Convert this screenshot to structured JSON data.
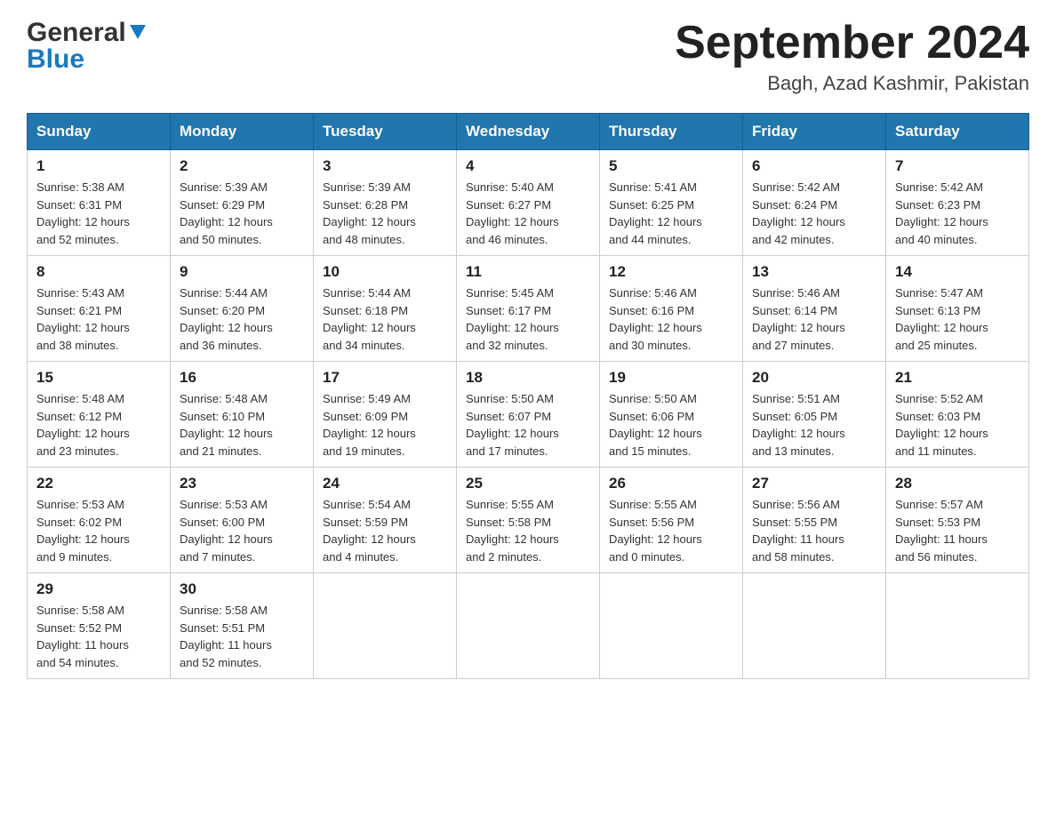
{
  "header": {
    "logo_general": "General",
    "logo_blue": "Blue",
    "month_title": "September 2024",
    "subtitle": "Bagh, Azad Kashmir, Pakistan"
  },
  "weekdays": [
    "Sunday",
    "Monday",
    "Tuesday",
    "Wednesday",
    "Thursday",
    "Friday",
    "Saturday"
  ],
  "weeks": [
    [
      {
        "day": "1",
        "sunrise": "5:38 AM",
        "sunset": "6:31 PM",
        "daylight": "12 hours and 52 minutes."
      },
      {
        "day": "2",
        "sunrise": "5:39 AM",
        "sunset": "6:29 PM",
        "daylight": "12 hours and 50 minutes."
      },
      {
        "day": "3",
        "sunrise": "5:39 AM",
        "sunset": "6:28 PM",
        "daylight": "12 hours and 48 minutes."
      },
      {
        "day": "4",
        "sunrise": "5:40 AM",
        "sunset": "6:27 PM",
        "daylight": "12 hours and 46 minutes."
      },
      {
        "day": "5",
        "sunrise": "5:41 AM",
        "sunset": "6:25 PM",
        "daylight": "12 hours and 44 minutes."
      },
      {
        "day": "6",
        "sunrise": "5:42 AM",
        "sunset": "6:24 PM",
        "daylight": "12 hours and 42 minutes."
      },
      {
        "day": "7",
        "sunrise": "5:42 AM",
        "sunset": "6:23 PM",
        "daylight": "12 hours and 40 minutes."
      }
    ],
    [
      {
        "day": "8",
        "sunrise": "5:43 AM",
        "sunset": "6:21 PM",
        "daylight": "12 hours and 38 minutes."
      },
      {
        "day": "9",
        "sunrise": "5:44 AM",
        "sunset": "6:20 PM",
        "daylight": "12 hours and 36 minutes."
      },
      {
        "day": "10",
        "sunrise": "5:44 AM",
        "sunset": "6:18 PM",
        "daylight": "12 hours and 34 minutes."
      },
      {
        "day": "11",
        "sunrise": "5:45 AM",
        "sunset": "6:17 PM",
        "daylight": "12 hours and 32 minutes."
      },
      {
        "day": "12",
        "sunrise": "5:46 AM",
        "sunset": "6:16 PM",
        "daylight": "12 hours and 30 minutes."
      },
      {
        "day": "13",
        "sunrise": "5:46 AM",
        "sunset": "6:14 PM",
        "daylight": "12 hours and 27 minutes."
      },
      {
        "day": "14",
        "sunrise": "5:47 AM",
        "sunset": "6:13 PM",
        "daylight": "12 hours and 25 minutes."
      }
    ],
    [
      {
        "day": "15",
        "sunrise": "5:48 AM",
        "sunset": "6:12 PM",
        "daylight": "12 hours and 23 minutes."
      },
      {
        "day": "16",
        "sunrise": "5:48 AM",
        "sunset": "6:10 PM",
        "daylight": "12 hours and 21 minutes."
      },
      {
        "day": "17",
        "sunrise": "5:49 AM",
        "sunset": "6:09 PM",
        "daylight": "12 hours and 19 minutes."
      },
      {
        "day": "18",
        "sunrise": "5:50 AM",
        "sunset": "6:07 PM",
        "daylight": "12 hours and 17 minutes."
      },
      {
        "day": "19",
        "sunrise": "5:50 AM",
        "sunset": "6:06 PM",
        "daylight": "12 hours and 15 minutes."
      },
      {
        "day": "20",
        "sunrise": "5:51 AM",
        "sunset": "6:05 PM",
        "daylight": "12 hours and 13 minutes."
      },
      {
        "day": "21",
        "sunrise": "5:52 AM",
        "sunset": "6:03 PM",
        "daylight": "12 hours and 11 minutes."
      }
    ],
    [
      {
        "day": "22",
        "sunrise": "5:53 AM",
        "sunset": "6:02 PM",
        "daylight": "12 hours and 9 minutes."
      },
      {
        "day": "23",
        "sunrise": "5:53 AM",
        "sunset": "6:00 PM",
        "daylight": "12 hours and 7 minutes."
      },
      {
        "day": "24",
        "sunrise": "5:54 AM",
        "sunset": "5:59 PM",
        "daylight": "12 hours and 4 minutes."
      },
      {
        "day": "25",
        "sunrise": "5:55 AM",
        "sunset": "5:58 PM",
        "daylight": "12 hours and 2 minutes."
      },
      {
        "day": "26",
        "sunrise": "5:55 AM",
        "sunset": "5:56 PM",
        "daylight": "12 hours and 0 minutes."
      },
      {
        "day": "27",
        "sunrise": "5:56 AM",
        "sunset": "5:55 PM",
        "daylight": "11 hours and 58 minutes."
      },
      {
        "day": "28",
        "sunrise": "5:57 AM",
        "sunset": "5:53 PM",
        "daylight": "11 hours and 56 minutes."
      }
    ],
    [
      {
        "day": "29",
        "sunrise": "5:58 AM",
        "sunset": "5:52 PM",
        "daylight": "11 hours and 54 minutes."
      },
      {
        "day": "30",
        "sunrise": "5:58 AM",
        "sunset": "5:51 PM",
        "daylight": "11 hours and 52 minutes."
      },
      null,
      null,
      null,
      null,
      null
    ]
  ]
}
